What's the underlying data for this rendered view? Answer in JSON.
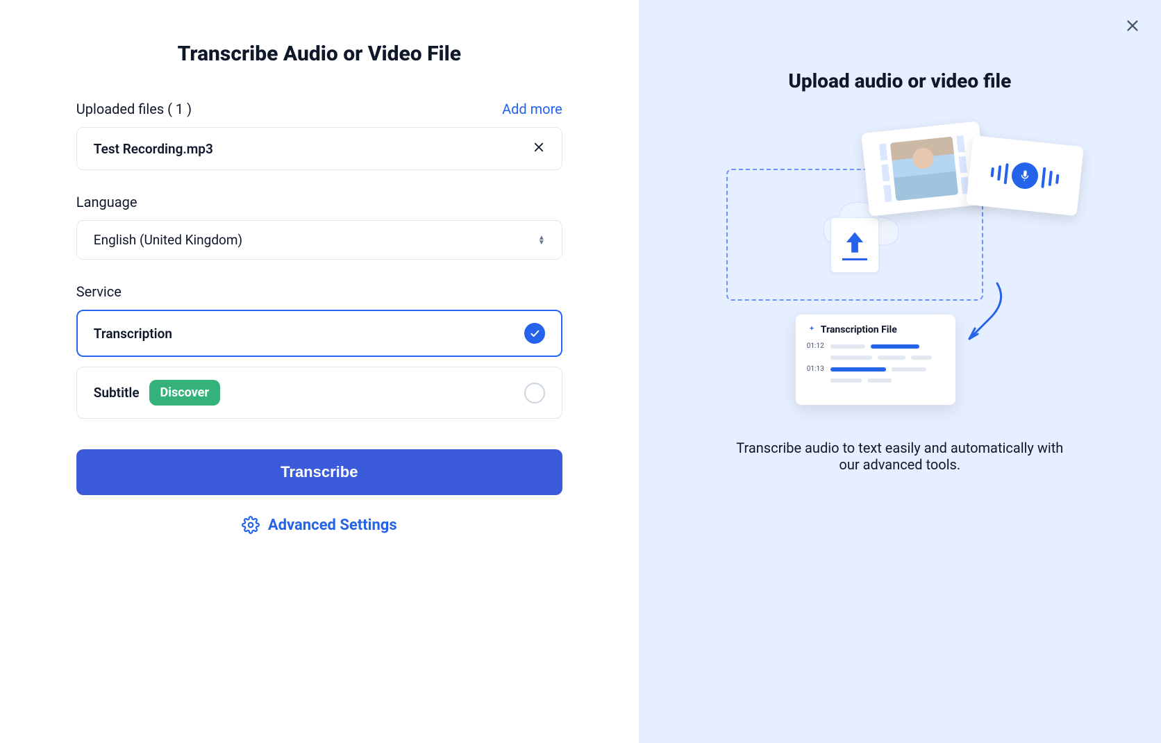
{
  "left_panel": {
    "title": "Transcribe Audio or Video File",
    "uploaded_label": "Uploaded files ( 1 )",
    "add_more": "Add more",
    "file_name": "Test Recording.mp3",
    "language_label": "Language",
    "language_value": "English (United Kingdom)",
    "service_label": "Service",
    "option_transcription": "Transcription",
    "option_subtitle": "Subtitle",
    "discover_badge": "Discover",
    "transcribe_button": "Transcribe",
    "advanced_settings": "Advanced Settings"
  },
  "right_panel": {
    "title": "Upload audio or video file",
    "description": "Transcribe audio to text easily and automatically with our advanced tools.",
    "illustration": {
      "file_label": "Transcription File",
      "timestamps": [
        "01:12",
        "01:13"
      ]
    }
  },
  "colors": {
    "primary": "#2563eb",
    "primary_btn": "#3b5bdb",
    "badge_green": "#34b27a",
    "right_bg": "#e6efff"
  }
}
